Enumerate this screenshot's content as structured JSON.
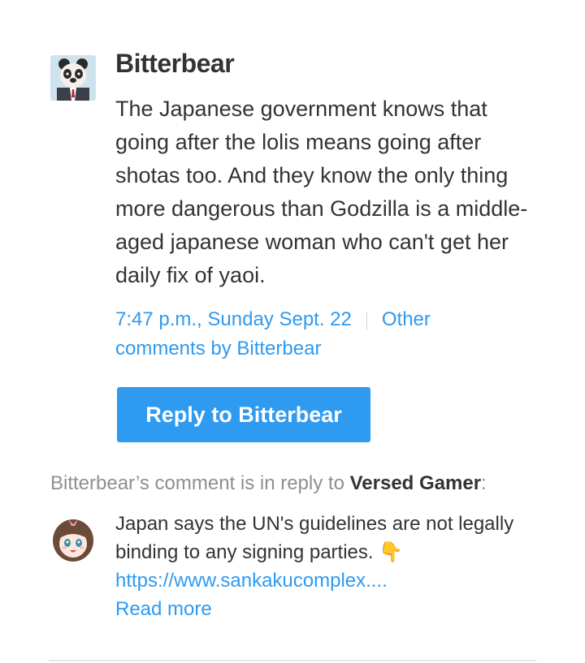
{
  "comment": {
    "author": "Bitterbear",
    "text": "The Japanese government knows that going after the lolis means going after shotas too. And they know the only thing more dangerous than Godzilla is a middle-aged japanese woman who can't get her daily fix of yaoi.",
    "timestamp": "7:47 p.m., Sunday Sept. 22",
    "other_comments_link": "Other comments by Bitterbear",
    "reply_button": "Reply to Bitterbear",
    "avatar_icon": "panda-avatar-icon"
  },
  "in_reply_to": {
    "prefix": "Bitterbear’s comment is in reply to ",
    "target": "Versed Gamer",
    "suffix": ":",
    "text": "Japan says the UN's guidelines are not legally binding to any signing parties. 👇",
    "link": "https://www.sankakucomplex....",
    "read_more": "Read more",
    "avatar_icon": "anime-girl-avatar-icon"
  },
  "colors": {
    "accent": "#2e9af0",
    "text": "#333333",
    "muted": "#8f8f8f"
  }
}
